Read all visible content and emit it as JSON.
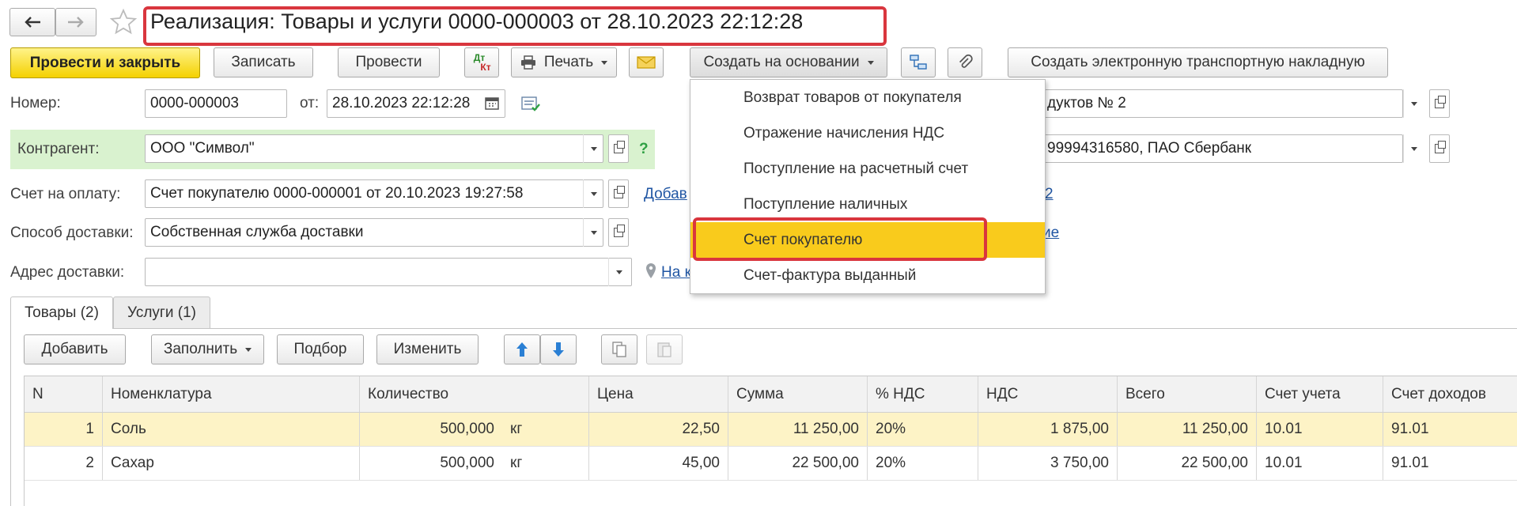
{
  "window": {
    "title": "Реализация: Товары и услуги 0000-000003 от 28.10.2023 22:12:28"
  },
  "toolbar": {
    "post_close": "Провести и закрыть",
    "save": "Записать",
    "post": "Провести",
    "dt_kt_top": "Дт",
    "dt_kt_bottom": "Кт",
    "print": "Печать",
    "create_based": "Создать на основании",
    "create_transport": "Создать электронную транспортную накладную"
  },
  "dropdown": {
    "items": [
      "Возврат товаров от покупателя",
      "Отражение начисления НДС",
      "Поступление на расчетный счет",
      "Поступление наличных",
      "Счет покупателю",
      "Счет-фактура выданный"
    ],
    "selected_index": 4
  },
  "form": {
    "number_label": "Номер:",
    "number_value": "0000-000003",
    "date_label": "от:",
    "date_value": "28.10.2023 22:12:28",
    "contractor_label": "Контрагент:",
    "contractor_value": "ООО \"Символ\"",
    "help": "?",
    "invoice_label": "Счет на оплату:",
    "invoice_value": "Счет покупателю 0000-000001 от 20.10.2023 19:27:58",
    "delivery_label": "Способ доставки:",
    "delivery_value": "Собственная служба доставки",
    "address_label": "Адрес доставки:",
    "address_value": "",
    "link_add": "Добав",
    "link_map": "На к",
    "right_field1": "дуктов № 2",
    "right_field2": "99994316580, ПАО Сбербанк",
    "right_link1": "2",
    "right_link2": "ие"
  },
  "tabs": [
    {
      "label": "Товары (2)",
      "active": true
    },
    {
      "label": "Услуги (1)",
      "active": false
    }
  ],
  "table_toolbar": {
    "add": "Добавить",
    "fill": "Заполнить",
    "pick": "Подбор",
    "change": "Изменить"
  },
  "table": {
    "columns": [
      "N",
      "Номенклатура",
      "Количество",
      "Цена",
      "Сумма",
      "% НДС",
      "НДС",
      "Всего",
      "Счет учета",
      "Счет доходов"
    ],
    "rows": [
      {
        "n": "1",
        "name": "Соль",
        "qty": "500,000",
        "unit": "кг",
        "price": "22,50",
        "sum": "11 250,00",
        "vat_rate": "20%",
        "vat": "1 875,00",
        "total": "11 250,00",
        "account": "10.01",
        "income": "91.01"
      },
      {
        "n": "2",
        "name": "Сахар",
        "qty": "500,000",
        "unit": "кг",
        "price": "45,00",
        "sum": "22 500,00",
        "vat_rate": "20%",
        "vat": "3 750,00",
        "total": "22 500,00",
        "account": "10.01",
        "income": "91.01"
      }
    ]
  },
  "colors": {
    "primary_button": "#f4d100",
    "selected_menu": "#f9cb1c",
    "highlight_border": "#d9363e",
    "contractor_bg": "#d9f2cf",
    "row_selected": "#fdf3c6",
    "link": "#1f55a3"
  }
}
